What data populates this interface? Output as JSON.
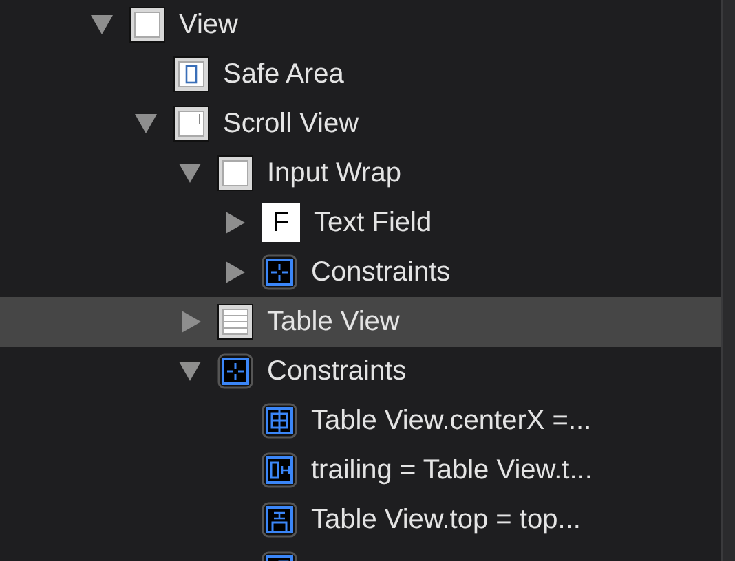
{
  "outline": [
    {
      "label": "View",
      "kind": "view",
      "expanded": true,
      "selected": false,
      "children": [
        {
          "label": "Safe Area",
          "kind": "safe-area",
          "selected": false
        },
        {
          "label": "Scroll View",
          "kind": "scroll-view",
          "expanded": true,
          "selected": false,
          "children": [
            {
              "label": "Input Wrap",
              "kind": "view",
              "expanded": true,
              "selected": false,
              "children": [
                {
                  "label": "Text Field",
                  "kind": "text-field",
                  "icon_text": "F",
                  "expanded": false,
                  "selected": false
                },
                {
                  "label": "Constraints",
                  "kind": "constraints",
                  "expanded": false,
                  "selected": false
                }
              ]
            },
            {
              "label": "Table View",
              "kind": "table-view",
              "expanded": false,
              "selected": true
            },
            {
              "label": "Constraints",
              "kind": "constraints",
              "expanded": true,
              "selected": false,
              "children": [
                {
                  "label": "Table View.centerX =...",
                  "kind": "center-x",
                  "selected": false
                },
                {
                  "label": "trailing = Table View.t...",
                  "kind": "trailing",
                  "selected": false
                },
                {
                  "label": "Table View.top = top...",
                  "kind": "top",
                  "selected": false
                },
                {
                  "kind": "leading",
                  "selected": false
                }
              ]
            }
          ]
        }
      ]
    }
  ]
}
